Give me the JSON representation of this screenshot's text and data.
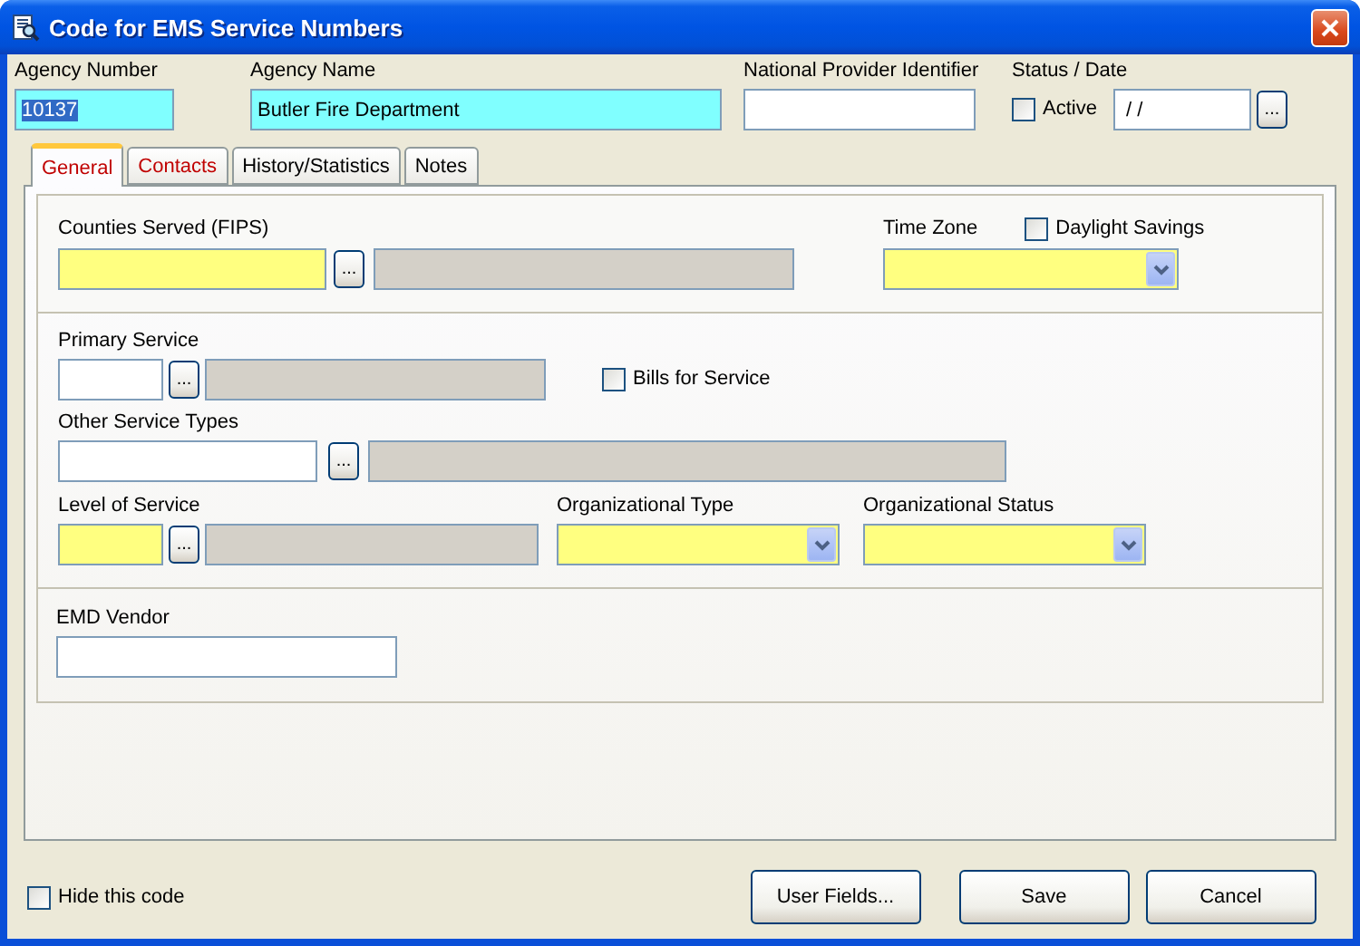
{
  "window": {
    "title": "Code for EMS Service Numbers"
  },
  "header": [
    {
      "label": "Agency Number",
      "value": "10137",
      "selected": true
    },
    {
      "label": "Agency Name",
      "value": "Butler Fire Department",
      "selected": false
    }
  ],
  "npi": {
    "label": "National Provider Identifier"
  },
  "status_date": {
    "label": "Status / Date",
    "active": {
      "label": "Active",
      "checked": false
    },
    "date": " / /",
    "button": "..."
  },
  "tabs": [
    {
      "label": "General",
      "selected": true
    },
    {
      "label": "Contacts",
      "selected": false
    },
    {
      "label": "History/Statistics",
      "selected": false
    },
    {
      "label": "Notes",
      "selected": false
    }
  ],
  "general": {
    "counties": {
      "label": "Counties Served (FIPS)",
      "required": true,
      "button": "..."
    },
    "time_zone": {
      "label": "Time Zone",
      "required": true
    },
    "daylight": {
      "label": "Daylight Savings",
      "checked": false
    },
    "primary_service": {
      "label": "Primary Service",
      "required": false,
      "button": "..."
    },
    "bills": {
      "label": "Bills for Service",
      "checked": false
    },
    "other_service": {
      "label": "Other Service Types",
      "required": false,
      "button": "..."
    },
    "level_of_service": {
      "label": "Level of Service",
      "required": true,
      "button": "..."
    },
    "org_type": {
      "label": "Organizational Type",
      "required": true
    },
    "org_status": {
      "label": "Organizational Status",
      "required": true
    },
    "emd_vendor": {
      "label": "EMD Vendor",
      "required": false
    }
  },
  "hide_code": {
    "label": "Hide this code",
    "checked": false
  },
  "buttons": [
    "User Fields...",
    "Save",
    "Cancel"
  ]
}
